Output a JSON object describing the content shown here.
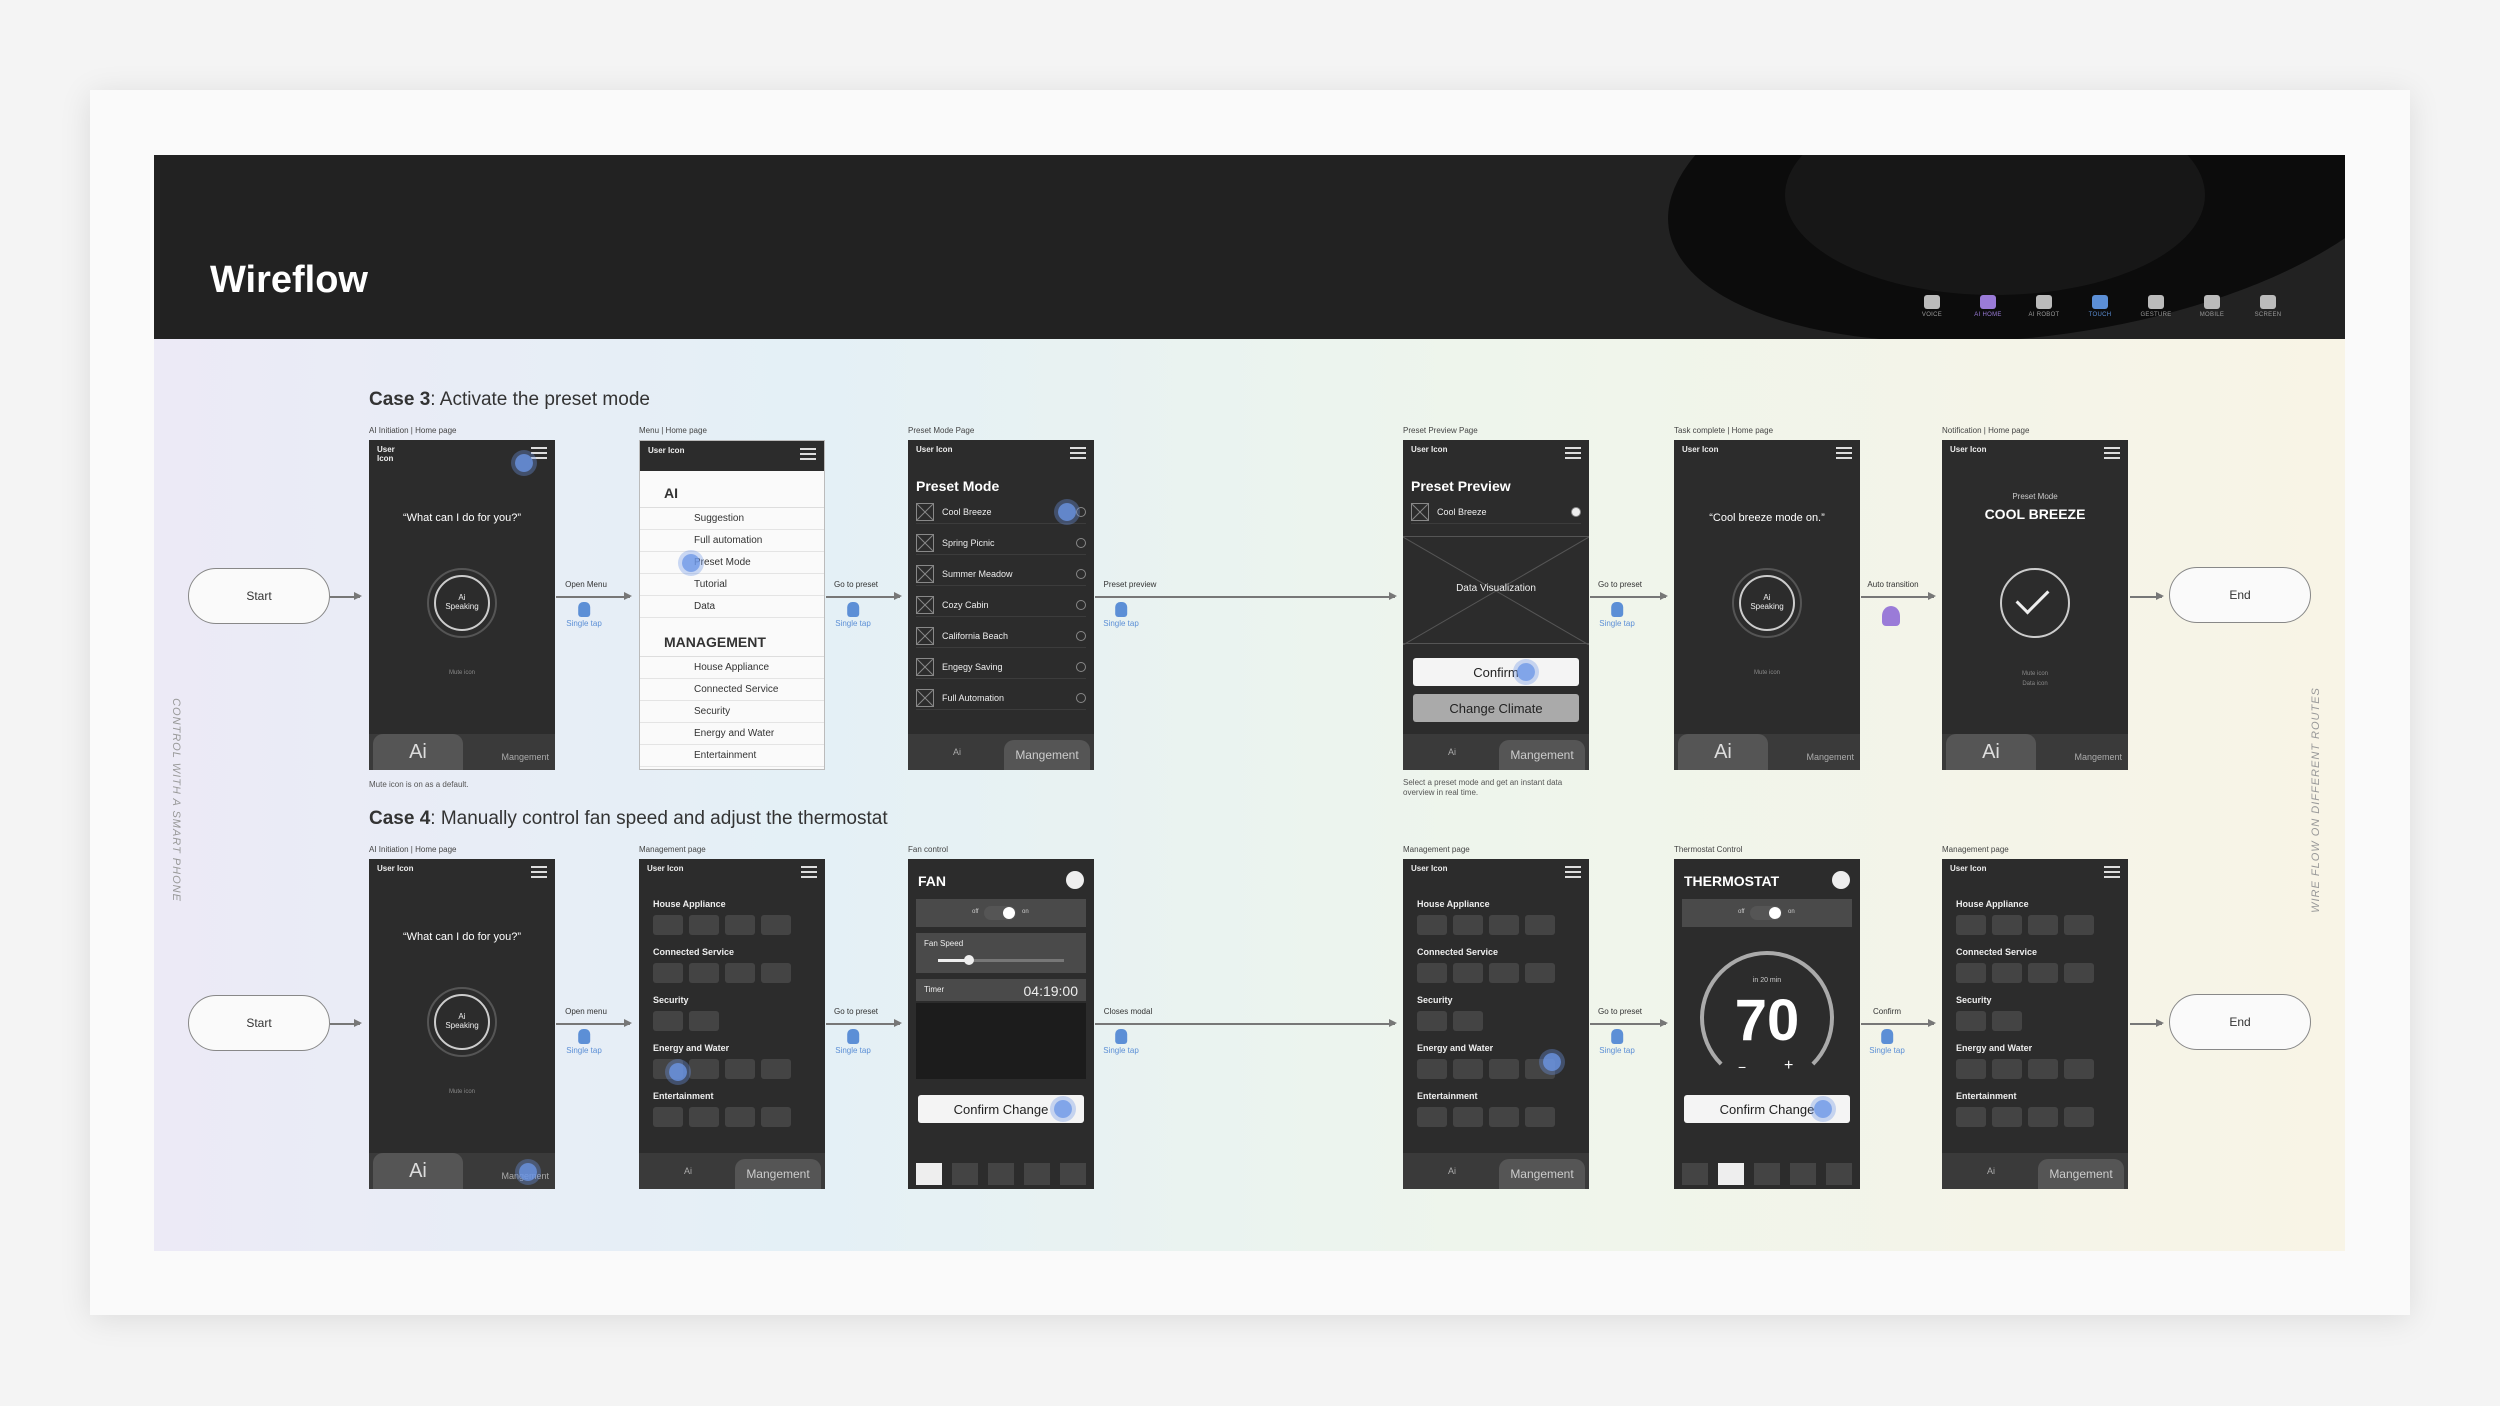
{
  "header": {
    "title": "Wireflow"
  },
  "legend": [
    {
      "label": "VOICE",
      "icon": "voice-icon",
      "color": "#bbbbbb"
    },
    {
      "label": "AI HOME",
      "icon": "ai-home-icon",
      "color": "#9a7bd8"
    },
    {
      "label": "AI ROBOT",
      "icon": "robot-icon",
      "color": "#bbbbbb"
    },
    {
      "label": "TOUCH",
      "icon": "touch-icon",
      "color": "#5c8fd6"
    },
    {
      "label": "GESTURE",
      "icon": "gesture-icon",
      "color": "#bbbbbb"
    },
    {
      "label": "MOBILE",
      "icon": "mobile-icon",
      "color": "#bbbbbb"
    },
    {
      "label": "SCREEN",
      "icon": "screen-icon",
      "color": "#bbbbbb"
    }
  ],
  "side_left": "CONTROL WITH A SMART PHONE",
  "side_right": "WIRE FLOW ON DIFFERENT ROUTES",
  "case3": {
    "title_bold": "Case 3",
    "title_rest": ": Activate the preset mode",
    "start": "Start",
    "end": "End",
    "frames": {
      "f1": "AI Initiation | Home page",
      "f2": "Menu | Home page",
      "f3": "Preset Mode Page",
      "f4": "Preset Preview Page",
      "f5": "Task complete | Home page",
      "f6": "Notification | Home page"
    },
    "connectors": {
      "c1": "Open Menu",
      "c2": "Go to preset",
      "c3": "Preset preview",
      "c4": "Go to preset",
      "c5": "Auto transition"
    },
    "tap_label": "Single tap",
    "note1": "Mute icon is on as a default.",
    "note2": "Select a preset mode and get an instant data overview in real time.",
    "user_icon": "User\nIcon",
    "menu_small": "menu",
    "ai_text": "Ai",
    "mgmt_text": "Mangement",
    "speech1": "“What can I do for you?”",
    "orb": "Ai\nSpeaking",
    "mute": "Mute icon",
    "menu": {
      "ai_header": "AI",
      "ai_items": [
        "Suggestion",
        "Full automation",
        "Preset Mode",
        "Tutorial",
        "Data"
      ],
      "mgmt_header": "MANAGEMENT",
      "mgmt_items": [
        "House Appliance",
        "Connected Service",
        "Security",
        "Energy and Water",
        "Entertainment"
      ]
    },
    "preset_title": "Preset Mode",
    "presets": [
      "Cool Breeze",
      "Spring Picnic",
      "Summer Meadow",
      "Cozy Cabin",
      "California Beach",
      "Engegy Saving",
      "Full Automation"
    ],
    "preview_title": "Preset Preview",
    "preview_item": "Cool Breeze",
    "data_viz": "Data Visualization",
    "confirm": "Confirm",
    "change_climate": "Change Climate",
    "speech2": "“Cool breeze mode on.”",
    "notif_small": "Preset Mode",
    "notif_big": "COOL BREEZE",
    "mute2": "Mute icon\nData icon"
  },
  "case4": {
    "title_bold": "Case 4",
    "title_rest": ": Manually control fan speed and adjust the thermostat",
    "start": "Start",
    "end": "End",
    "frames": {
      "f1": "AI Initiation | Home page",
      "f2": "Management page",
      "f3": "Fan control",
      "f4": "Management page",
      "f5": "Thermostat Control",
      "f6": "Management page"
    },
    "connectors": {
      "c1": "Open menu",
      "c2": "Go to preset",
      "c3": "Closes modal",
      "c4": "Go to preset",
      "c5": "Confirm"
    },
    "sections": [
      "House Appliance",
      "Connected Service",
      "Security",
      "Energy and Water",
      "Entertainment"
    ],
    "fan_title": "FAN",
    "fan_speed": "Fan Speed",
    "timer": "Timer",
    "timer_value": "04:19:00",
    "confirm_change": "Confirm Change",
    "thermo_title": "THERMOSTAT",
    "thermo_value": "70",
    "thermo_sub": "in 20 min",
    "on": "on",
    "off": "off"
  }
}
